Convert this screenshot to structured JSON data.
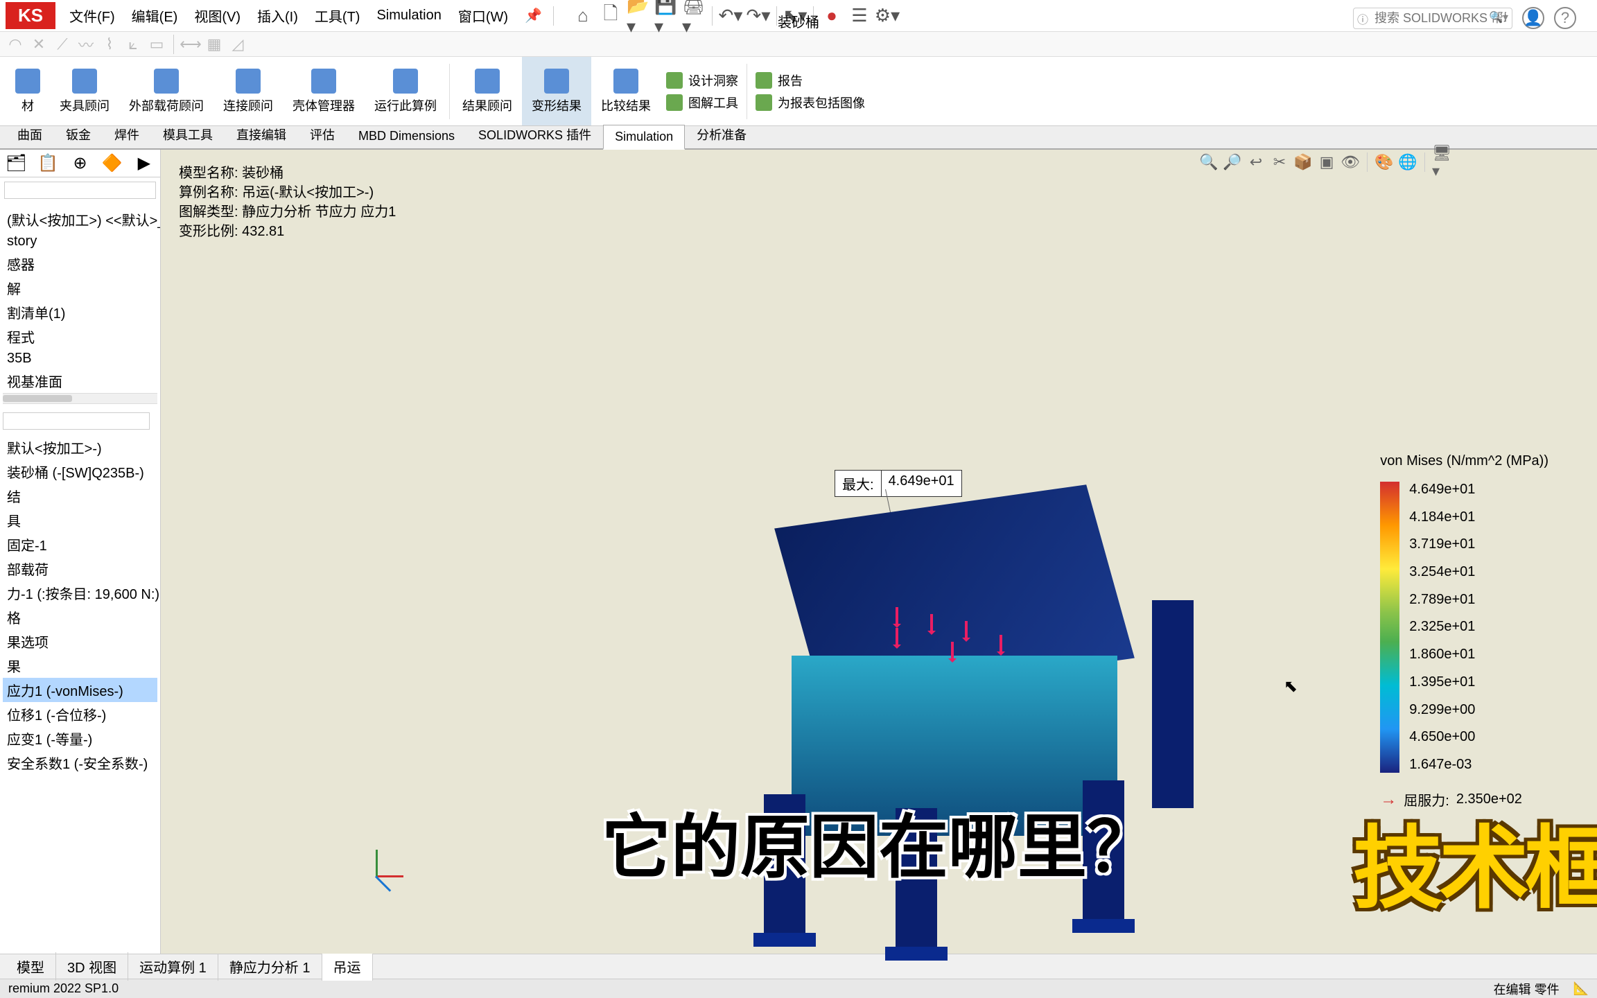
{
  "app": {
    "logo": "KS",
    "title": "装砂桶",
    "search_placeholder": "搜索 SOLIDWORKS 帮助"
  },
  "menu": {
    "file": "文件(F)",
    "edit": "编辑(E)",
    "view": "视图(V)",
    "insert": "插入(I)",
    "tools": "工具(T)",
    "simulation": "Simulation",
    "window": "窗口(W)"
  },
  "ribbon": {
    "items": [
      {
        "label": "材"
      },
      {
        "label": "夹具顾问"
      },
      {
        "label": "外部载荷顾问"
      },
      {
        "label": "连接顾问"
      },
      {
        "label": "壳体管理器"
      },
      {
        "label": "运行此算例"
      },
      {
        "label": "结果顾问"
      },
      {
        "label": "变形结果"
      },
      {
        "label": "比较结果"
      }
    ],
    "small": [
      {
        "label": "设计洞察"
      },
      {
        "label": "图解工具"
      }
    ],
    "small2": [
      {
        "label": "报告"
      },
      {
        "label": "为报表包括图像"
      }
    ]
  },
  "tabs": {
    "items": [
      "曲面",
      "钣金",
      "焊件",
      "模具工具",
      "直接编辑",
      "评估",
      "MBD Dimensions",
      "SOLIDWORKS 插件",
      "Simulation",
      "分析准备"
    ],
    "active": "Simulation"
  },
  "tree": {
    "config": "(默认<按加工>) <<默认>_显示",
    "upper": [
      "story",
      "感器",
      "解",
      "割清单(1)",
      "程式",
      "35B",
      "视基准面"
    ],
    "study_config": "默认<按加工>-)",
    "part": "装砂桶 (-[SW]Q235B-)",
    "items": [
      "结",
      "具",
      " 固定-1",
      "部载荷",
      " 力-1 (:按条目: 19,600 N:)",
      "格",
      "果选项",
      "果"
    ],
    "results": [
      {
        "label": "应力1 (-vonMises-)",
        "selected": true
      },
      {
        "label": "位移1 (-合位移-)",
        "selected": false
      },
      {
        "label": "应变1 (-等量-)",
        "selected": false
      },
      {
        "label": "安全系数1 (-安全系数-)",
        "selected": false
      }
    ]
  },
  "model_info": {
    "line1": "模型名称: 装砂桶",
    "line2": "算例名称: 吊运(-默认<按加工>-)",
    "line3": "图解类型: 静应力分析 节应力 应力1",
    "line4": "变形比例: 432.81"
  },
  "callout": {
    "label": "最大:",
    "value": "4.649e+01"
  },
  "legend": {
    "title": "von Mises (N/mm^2 (MPa))",
    "values": [
      "4.649e+01",
      "4.184e+01",
      "3.719e+01",
      "3.254e+01",
      "2.789e+01",
      "2.325e+01",
      "1.860e+01",
      "1.395e+01",
      "9.299e+00",
      "4.650e+00",
      "1.647e-03"
    ],
    "yield_label": "屈服力:",
    "yield_value": "2.350e+02"
  },
  "bottom_tabs": {
    "items": [
      "模型",
      "3D 视图",
      "运动算例 1",
      "静应力分析 1",
      "吊运"
    ],
    "active": "吊运"
  },
  "status": {
    "version": "remium 2022 SP1.0",
    "edit": "在编辑 零件"
  },
  "subtitle": "它的原因在哪里？",
  "watermark": "技术框"
}
